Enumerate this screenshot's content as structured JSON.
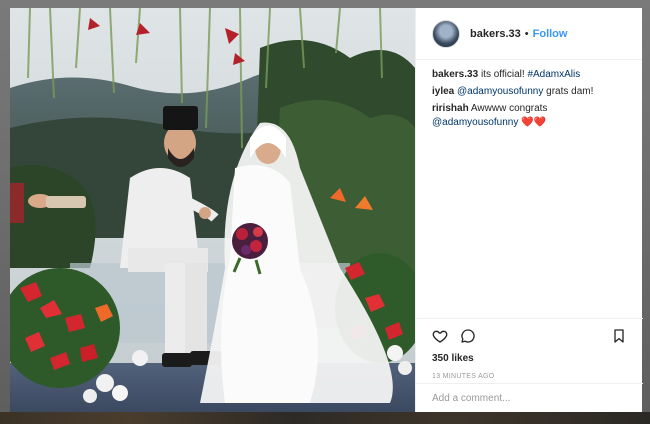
{
  "post": {
    "username": "bakers.33",
    "separator": "•",
    "follow_label": "Follow"
  },
  "comments": [
    {
      "user": "bakers.33",
      "text_before": "its official!",
      "mention": "",
      "hashtag": "#AdamxAlis",
      "text_after": ""
    },
    {
      "user": "iylea",
      "text_before": "",
      "mention": "@adamyousofunny",
      "hashtag": "",
      "text_after": "grats dam!"
    },
    {
      "user": "ririshah",
      "text_before": "Awwww congrats",
      "mention": "@adamyousofunny",
      "hashtag": "",
      "text_after": ""
    }
  ],
  "comment_emoji": "❤️❤️",
  "actions": {
    "likes": "350 likes",
    "timestamp": "13 MINUTES AGO"
  },
  "add_comment": {
    "placeholder": "Add a comment..."
  },
  "icons": {
    "like": "heart-outline-icon",
    "comment": "speech-bubble-icon",
    "save": "bookmark-icon",
    "avatar": "user-avatar"
  },
  "colors": {
    "link_blue": "#3897f0",
    "mention_navy": "#003569",
    "text_dark": "#262626",
    "muted_gray": "#999999"
  }
}
